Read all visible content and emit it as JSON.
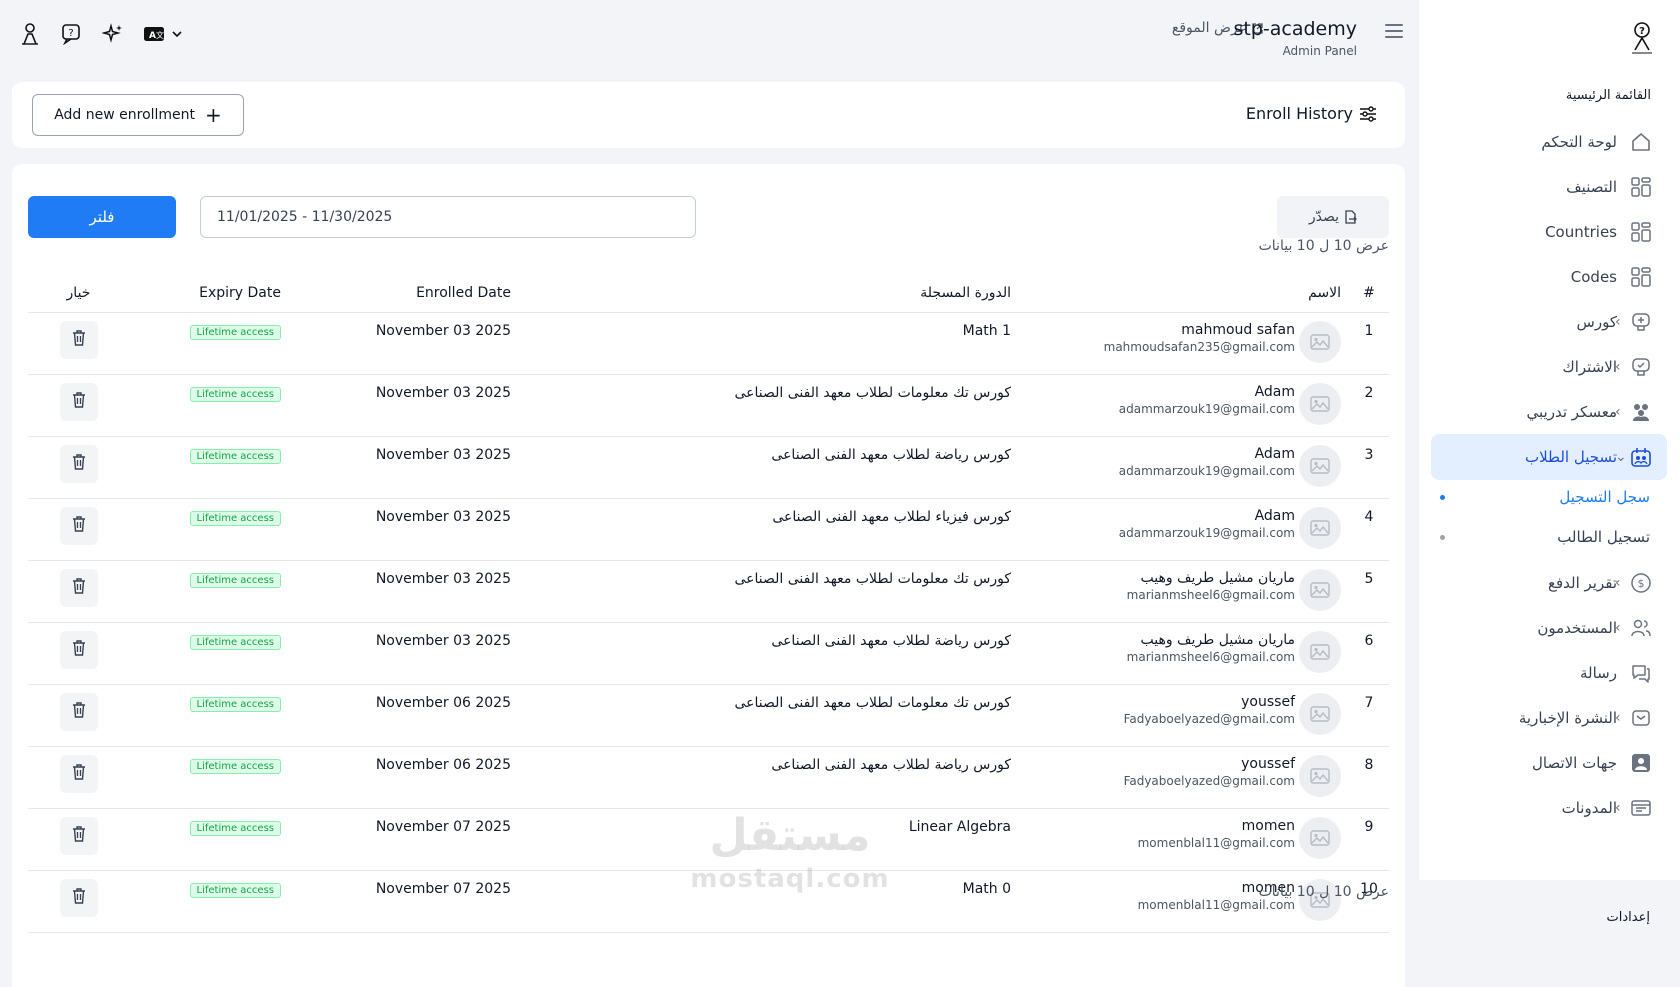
{
  "app": {
    "title": "stp-academy",
    "subtitle": "Admin Panel",
    "view_site": "عرض الموقع"
  },
  "header": {
    "add_button": "Add new enrollment",
    "title": "Enroll History"
  },
  "filters": {
    "filter_button": "فلتر",
    "date_range": "11/01/2025 - 11/30/2025",
    "export_button": "يصدّر",
    "showing_top": "عرض 10 ل 10 بيانات",
    "showing_bottom": "عرض 10 ل 10 بيانات"
  },
  "table": {
    "columns": {
      "index": "#",
      "name": "الاسم",
      "course": "الدورة المسجلة",
      "enrolled": "Enrolled Date",
      "expiry": "Expiry Date",
      "action": "خيار"
    },
    "rows": [
      {
        "index": "1",
        "name": "mahmoud safan",
        "email": "mahmoudsafan235@gmail.com",
        "course": "Math 1",
        "enrolled": "November 03 2025",
        "expiry": "Lifetime access"
      },
      {
        "index": "2",
        "name": "Adam",
        "email": "adammarzouk19@gmail.com",
        "course": "كورس تك معلومات لطلاب معهد الفنى الصناعى",
        "enrolled": "November 03 2025",
        "expiry": "Lifetime access"
      },
      {
        "index": "3",
        "name": "Adam",
        "email": "adammarzouk19@gmail.com",
        "course": "كورس رياضة لطلاب معهد الفنى الصناعى",
        "enrolled": "November 03 2025",
        "expiry": "Lifetime access"
      },
      {
        "index": "4",
        "name": "Adam",
        "email": "adammarzouk19@gmail.com",
        "course": "كورس فيزياء لطلاب معهد الفنى الصناعى",
        "enrolled": "November 03 2025",
        "expiry": "Lifetime access"
      },
      {
        "index": "5",
        "name": "ماريان مشيل طريف وهيب",
        "email": "marianmsheel6@gmail.com",
        "course": "كورس تك معلومات لطلاب معهد الفنى الصناعى",
        "enrolled": "November 03 2025",
        "expiry": "Lifetime access"
      },
      {
        "index": "6",
        "name": "ماريان مشيل طريف وهيب",
        "email": "marianmsheel6@gmail.com",
        "course": "كورس رياضة لطلاب معهد الفنى الصناعى",
        "enrolled": "November 03 2025",
        "expiry": "Lifetime access"
      },
      {
        "index": "7",
        "name": "youssef",
        "email": "Fadyaboelyazed@gmail.com",
        "course": "كورس تك معلومات لطلاب معهد الفنى الصناعى",
        "enrolled": "November 06 2025",
        "expiry": "Lifetime access"
      },
      {
        "index": "8",
        "name": "youssef",
        "email": "Fadyaboelyazed@gmail.com",
        "course": "كورس رياضة لطلاب معهد الفنى الصناعى",
        "enrolled": "November 06 2025",
        "expiry": "Lifetime access"
      },
      {
        "index": "9",
        "name": "momen",
        "email": "momenblal11@gmail.com",
        "course": "Linear Algebra",
        "enrolled": "November 07 2025",
        "expiry": "Lifetime access"
      },
      {
        "index": "10",
        "name": "momen",
        "email": "momenblal11@gmail.com",
        "course": "Math 0",
        "enrolled": "November 07 2025",
        "expiry": "Lifetime access"
      }
    ]
  },
  "sidebar": {
    "section_main": "القائمة الرئيسية",
    "items": [
      {
        "label": "لوحة التحكم",
        "icon": "home-icon"
      },
      {
        "label": "التصنيف",
        "icon": "grid-icon"
      },
      {
        "label": "Countries",
        "icon": "grid-icon"
      },
      {
        "label": "Codes",
        "icon": "grid-icon"
      },
      {
        "label": "كورس",
        "icon": "course-icon"
      },
      {
        "label": "الاشتراك",
        "icon": "subscription-icon"
      },
      {
        "label": "معسكر تدريبي",
        "icon": "users-group-icon"
      },
      {
        "label": "تسجيل الطلاب",
        "icon": "enroll-icon"
      },
      {
        "label": "تقرير الدفع",
        "icon": "dollar-icon"
      },
      {
        "label": "المستخدمون",
        "icon": "users-icon"
      },
      {
        "label": "رسالة",
        "icon": "message-icon"
      },
      {
        "label": "النشرة الإخبارية",
        "icon": "newsletter-icon"
      },
      {
        "label": "جهات الاتصال",
        "icon": "contact-icon"
      },
      {
        "label": "المدونات",
        "icon": "blog-icon"
      }
    ],
    "sub_items": [
      {
        "label": "سجل التسجيل"
      },
      {
        "label": "تسجيل الطالب"
      }
    ],
    "section_settings": "إعدادات"
  },
  "watermark": {
    "arabic": "مستقل",
    "latin": "mostaql.com"
  },
  "colors": {
    "primary": "#1f7cf5",
    "active_bg": "#e3efff",
    "badge_green": "#16a34a"
  }
}
